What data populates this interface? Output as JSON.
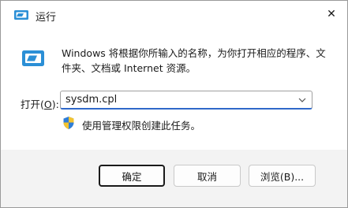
{
  "window": {
    "title": "运行",
    "close_label": "✕"
  },
  "content": {
    "description": "Windows 将根据你所输入的名称，为你打开相应的程序、文件夹、文档或 Internet 资源。",
    "open_label": "打开(",
    "open_accel": "O",
    "open_label_end": "):",
    "command_value": "sysdm.cpl",
    "uac_text": "使用管理权限创建此任务。"
  },
  "buttons": {
    "ok_label": "确定",
    "cancel_label": "取消",
    "browse_label": "浏览(B)..."
  }
}
